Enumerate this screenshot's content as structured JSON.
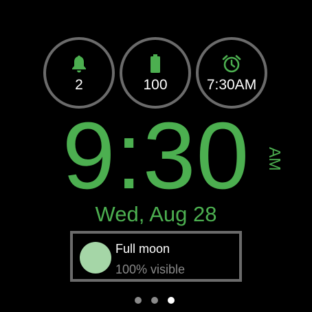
{
  "complications": {
    "notifications": {
      "icon": "bell-icon",
      "value": "2"
    },
    "battery": {
      "icon": "battery-icon",
      "value": "100"
    },
    "alarm": {
      "icon": "alarm-clock-icon",
      "value": "7:30AM"
    }
  },
  "clock": {
    "time": "9:30",
    "ampm": "AM",
    "date": "Wed, Aug 28"
  },
  "moon": {
    "icon": "moon-phase-icon",
    "title": "Full moon",
    "subtitle": "100% visible"
  },
  "pager": {
    "count": 3,
    "active_index": 2
  },
  "colors": {
    "accent": "#4caf50",
    "ring": "#6b6b6b",
    "moon": "#a5d6a7",
    "background": "#000000"
  }
}
